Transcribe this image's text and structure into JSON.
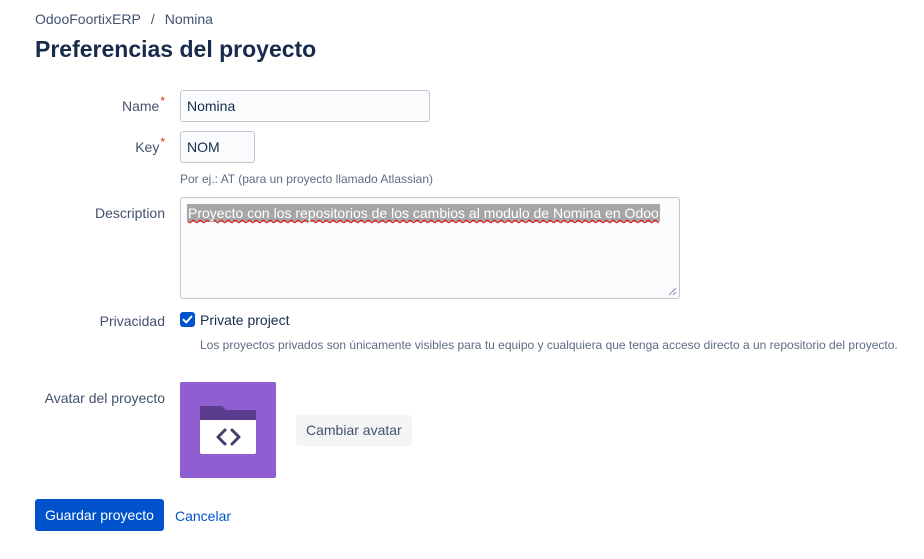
{
  "breadcrumb": {
    "items": [
      "OdooFoortixERP",
      "Nomina"
    ],
    "separator": "/"
  },
  "page_title": "Preferencias del proyecto",
  "form": {
    "name": {
      "label": "Name",
      "required_marker": "*",
      "value": "Nomina"
    },
    "key": {
      "label": "Key",
      "required_marker": "*",
      "value": "NOM",
      "hint": "Por ej.: AT (para un proyecto llamado Atlassian)"
    },
    "description": {
      "label": "Description",
      "value": "Proyecto con los repositorios de los cambios al modulo de Nomina en Odoo"
    },
    "privacy": {
      "label": "Privacidad",
      "checkbox_label": "Private project",
      "checked": true,
      "hint": "Los proyectos privados son únicamente visibles para tu equipo y cualquiera que tenga acceso directo a un repositorio del proyecto."
    },
    "avatar": {
      "label": "Avatar del proyecto",
      "change_button": "Cambiar avatar",
      "icon": "code-folder-icon",
      "color": "#8f5fd2"
    }
  },
  "actions": {
    "save_label": "Guardar proyecto",
    "cancel_label": "Cancelar"
  },
  "colors": {
    "primary": "#0052cc",
    "required": "#de350b",
    "text": "#172b4d"
  }
}
